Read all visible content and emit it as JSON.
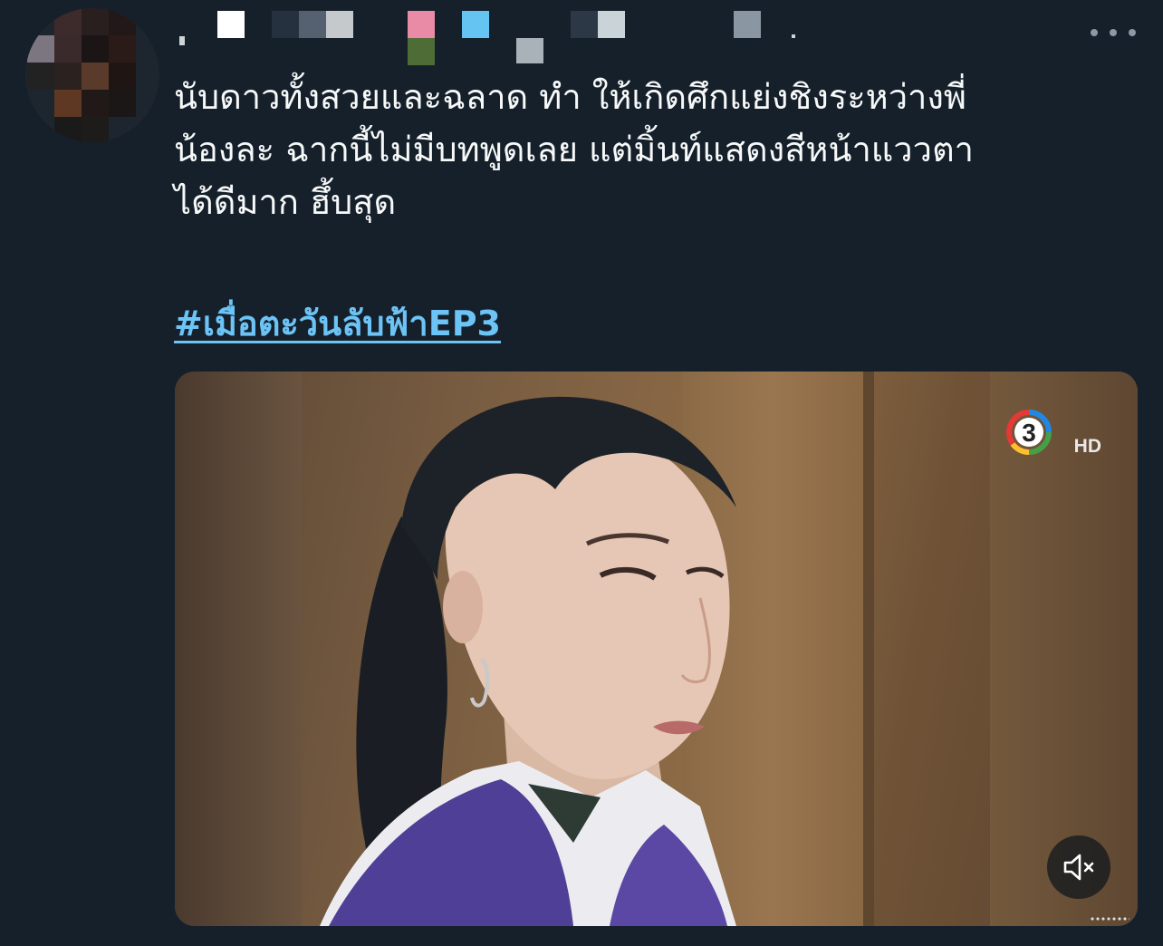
{
  "tweet": {
    "text": "นับดาวทั้งสวยและฉลาด ทำ ให้เกิดศึกแย่งชิงระหว่างพี่\nน้องละ ฉากนี้ไม่มีบทพูดเลย แต่มิ้นท์แสดงสีหน้าแววตา\nได้ดีมาก ฮึ้บสุด",
    "hashtag": "#เมื่อตะวันลับฟ้าEP3"
  },
  "header": {
    "more_icon": "more-horizontal-icon"
  },
  "media": {
    "channel_logo": "channel-3-logo",
    "channel_hd": "HD",
    "mute_icon": "speaker-muted-icon"
  },
  "colors": {
    "background": "#15202b",
    "text": "#f7f9f9",
    "link": "#6cc3f5",
    "icon": "#8b98a5"
  }
}
